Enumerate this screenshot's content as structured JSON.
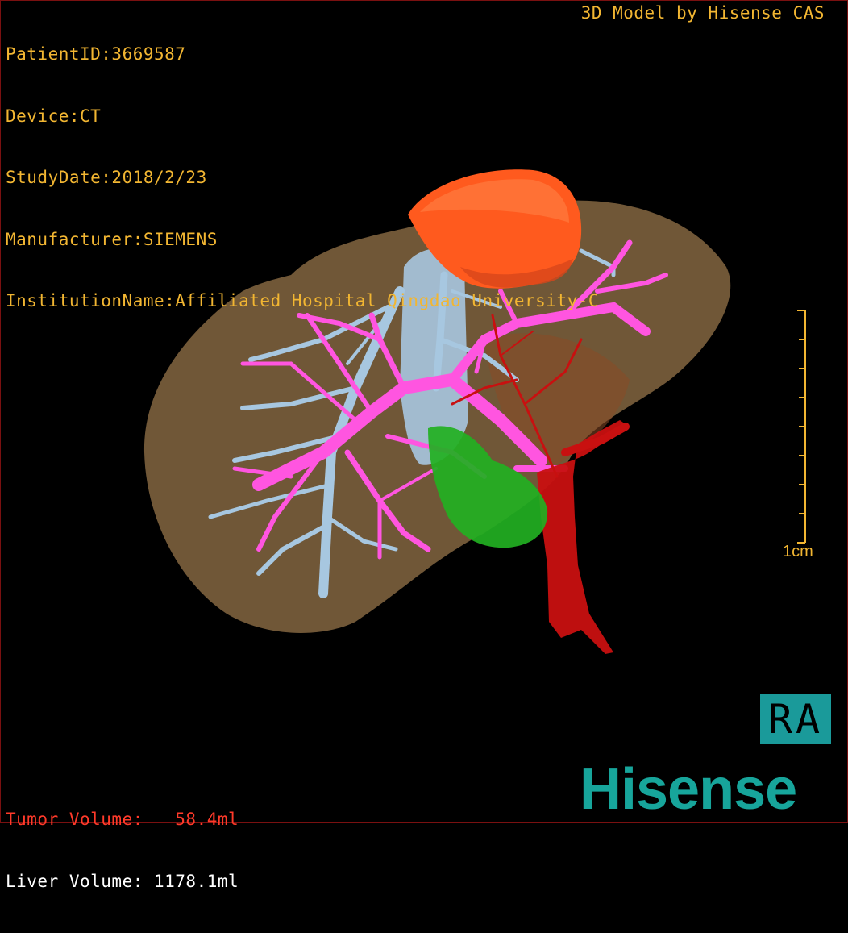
{
  "header": {
    "patient_id": "PatientID:3669587",
    "device": "Device:CT",
    "study_date": "StudyDate:2018/2/23",
    "manufacturer": "Manufacturer:SIEMENS",
    "institution": "InstitutionName:Affiliated Hospital Qingdao University-C",
    "credit": "3D Model by Hisense CAS"
  },
  "volumes": {
    "tumor": "Tumor Volume:   58.4ml",
    "liver": "Liver Volume: 1178.1ml"
  },
  "scale": {
    "label": "1cm"
  },
  "orientation": {
    "label": "RA"
  },
  "logo": {
    "text": "Hisense"
  },
  "colors": {
    "liver": "#7a5e3c",
    "tumor": "#ff5a1e",
    "portal_vein": "#ff55e0",
    "hepatic_vein": "#a7c7e0",
    "artery": "#c81010",
    "gallbladder": "#22b022",
    "text": "#f2b632",
    "logo": "#17a59b"
  },
  "icons": {
    "orientation": "orientation-marker-icon"
  }
}
